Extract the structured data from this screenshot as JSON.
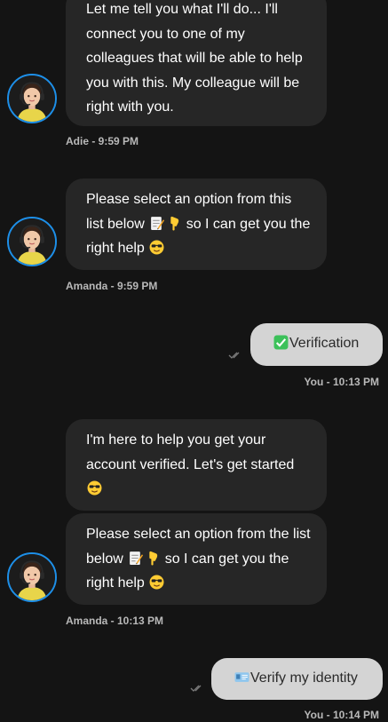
{
  "messages": {
    "m1": {
      "text_line1": "Let me tell you what I'll do... I'll",
      "text_rest": "connect you to one of my colleagues that will be able to help you with this. My colleague will be right with you."
    },
    "m1_meta": "Adie - 9:59 PM",
    "m2": {
      "text_a": "Please select an option from this list below ",
      "text_b": " so I can get you the right help "
    },
    "m2_meta": "Amanda - 9:59 PM",
    "u1": {
      "text": "Verification"
    },
    "u1_meta": "You - 10:13 PM",
    "m3": {
      "text": "I'm here to help you get your account verified. Let's get started "
    },
    "m4": {
      "text_a": "Please select an option from the list below ",
      "text_b": " so I can get you the right help "
    },
    "m4_meta": "Amanda - 10:13 PM",
    "u2": {
      "text": "Verify my identity"
    },
    "u2_meta": "You - 10:14 PM"
  },
  "icons": {
    "avatar": "agent-headset-avatar",
    "memo": "memo-emoji",
    "pointing_down": "backhand-index-pointing-down-emoji",
    "sunglasses": "smiling-face-with-sunglasses-emoji",
    "check": "check-mark-button-emoji",
    "id_card": "identification-card-emoji",
    "read_receipt": "double-check-icon"
  },
  "colors": {
    "background": "#141414",
    "agent_bubble": "#262626",
    "user_bubble": "#d4d4d4",
    "avatar_ring": "#1d8fe8"
  }
}
